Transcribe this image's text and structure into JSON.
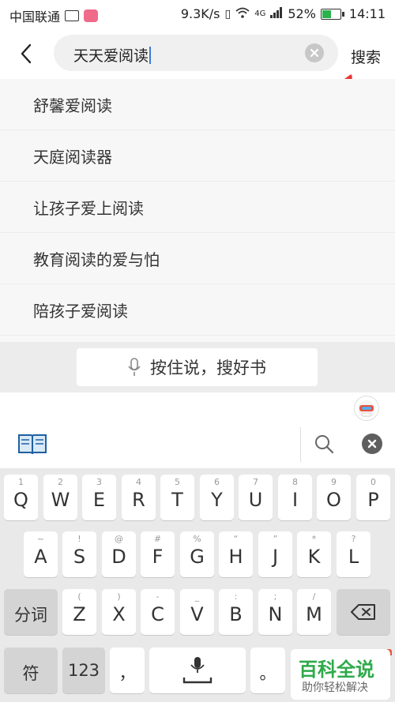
{
  "status_bar": {
    "carrier": "中国联通",
    "speed": "9.3K/s",
    "network": "4G",
    "battery": "52%",
    "battery_level": 0.52,
    "time": "14:11"
  },
  "search": {
    "query": "天天爱阅读",
    "submit_label": "搜索"
  },
  "suggestions": [
    "舒馨爱阅读",
    "天庭阅读器",
    "让孩子爱上阅读",
    "教育阅读的爱与怕",
    "陪孩子爱阅读"
  ],
  "voice": {
    "label": "按住说，搜好书"
  },
  "keyboard": {
    "row1": [
      {
        "hint": "1",
        "key": "Q"
      },
      {
        "hint": "2",
        "key": "W"
      },
      {
        "hint": "3",
        "key": "E"
      },
      {
        "hint": "4",
        "key": "R"
      },
      {
        "hint": "5",
        "key": "T"
      },
      {
        "hint": "6",
        "key": "Y"
      },
      {
        "hint": "7",
        "key": "U"
      },
      {
        "hint": "8",
        "key": "I"
      },
      {
        "hint": "9",
        "key": "O"
      },
      {
        "hint": "0",
        "key": "P"
      }
    ],
    "row2": [
      {
        "hint": "~",
        "key": "A"
      },
      {
        "hint": "!",
        "key": "S"
      },
      {
        "hint": "@",
        "key": "D"
      },
      {
        "hint": "#",
        "key": "F"
      },
      {
        "hint": "%",
        "key": "G"
      },
      {
        "hint": "“",
        "key": "H"
      },
      {
        "hint": "”",
        "key": "J"
      },
      {
        "hint": "*",
        "key": "K"
      },
      {
        "hint": "?",
        "key": "L"
      }
    ],
    "row3": [
      {
        "hint": "(",
        "key": "Z"
      },
      {
        "hint": ")",
        "key": "X"
      },
      {
        "hint": "-",
        "key": "C"
      },
      {
        "hint": "_",
        "key": "V"
      },
      {
        "hint": ":",
        "key": "B"
      },
      {
        "hint": ";",
        "key": "N"
      },
      {
        "hint": "/",
        "key": "M"
      }
    ],
    "segment_label": "分词",
    "symbol_label": "符",
    "numeric_label": "123",
    "comma_label": "，",
    "period_label": "。"
  },
  "watermark": {
    "title": "百科全说",
    "subtitle": "助你轻松解决"
  },
  "colors": {
    "accent_green": "#2eaa4a",
    "annotation_red": "#e53935",
    "caret_blue": "#3a7bd5"
  }
}
